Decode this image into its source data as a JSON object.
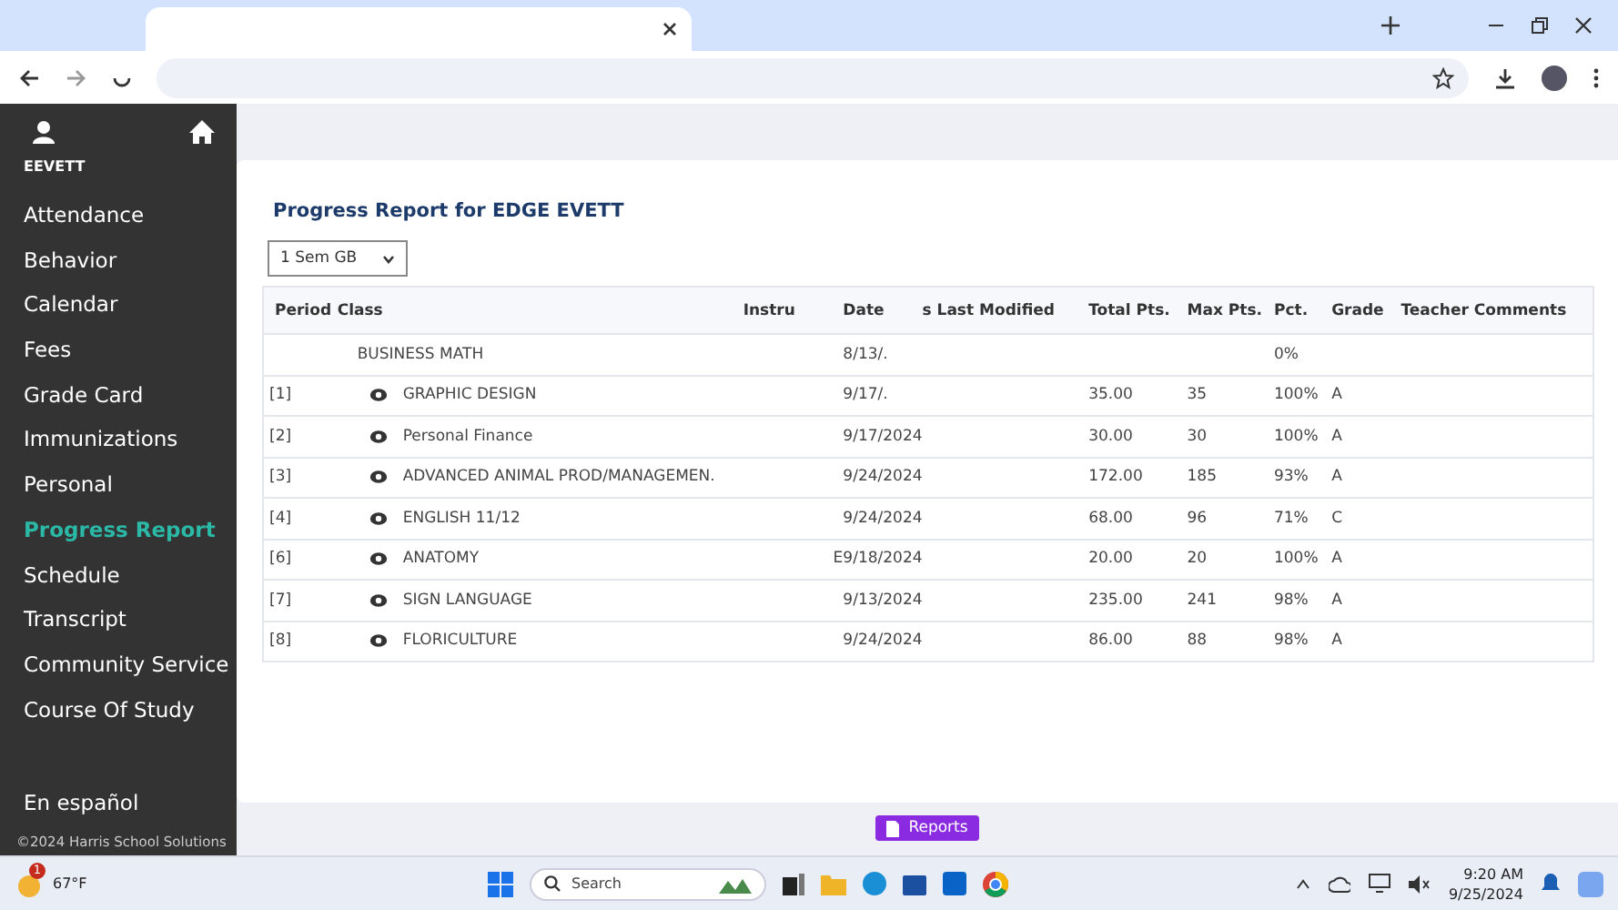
{
  "sidebar": {
    "user_name": "EEVETT",
    "items": [
      {
        "label": "Attendance",
        "selected": false
      },
      {
        "label": "Behavior",
        "selected": false
      },
      {
        "label": "Calendar",
        "selected": false
      },
      {
        "label": "Fees",
        "selected": false
      },
      {
        "label": "Grade Card",
        "selected": false
      },
      {
        "label": "Immunizations",
        "selected": false
      },
      {
        "label": "Personal",
        "selected": false
      },
      {
        "label": "Progress Report",
        "selected": true
      },
      {
        "label": "Schedule",
        "selected": false
      },
      {
        "label": "Transcript",
        "selected": false
      },
      {
        "label": "Community Service",
        "selected": false
      },
      {
        "label": "Course Of Study",
        "selected": false
      }
    ],
    "language_link": "En español",
    "copyright": "©2024",
    "copyright_link": "Harris School Solutions"
  },
  "report": {
    "title": "Progress Report for EDGE EVETT",
    "term_select": "1 Sem GB",
    "table": {
      "columns": [
        "Period",
        "Class",
        "Instru",
        "Date",
        "s Last Modified",
        "Total Pts.",
        "Max Pts.",
        "Pct.",
        "Grade",
        "Teacher Comments"
      ],
      "rows": [
        {
          "kind": "plain",
          "period": "",
          "class": "BUSINESS MATH",
          "instructor": "",
          "date": "8/13/.",
          "total": "",
          "max": "",
          "pct": "0%",
          "grade": ""
        },
        {
          "kind": "course",
          "period": "[1]",
          "class": "GRAPHIC DESIGN",
          "instructor": "",
          "date": "9/17/.",
          "total": "35.00",
          "max": "35",
          "pct": "100%",
          "grade": "A"
        },
        {
          "kind": "course",
          "period": "[2]",
          "class": "Personal Finance",
          "instructor": "",
          "date": "9/17/2024",
          "total": "30.00",
          "max": "30",
          "pct": "100%",
          "grade": "A"
        },
        {
          "kind": "course",
          "period": "[3]",
          "class": "ADVANCED ANIMAL PROD/MANAGEMEN.",
          "instructor": "",
          "date": "9/24/2024",
          "total": "172.00",
          "max": "185",
          "pct": "93%",
          "grade": "A"
        },
        {
          "kind": "course",
          "period": "[4]",
          "class": "ENGLISH 11/12",
          "instructor": "",
          "date": "9/24/2024",
          "total": "68.00",
          "max": "96",
          "pct": "71%",
          "grade": "C"
        },
        {
          "kind": "course",
          "period": "[6]",
          "class": "ANATOMY",
          "instructor": "E",
          "date": "9/18/2024",
          "total": "20.00",
          "max": "20",
          "pct": "100%",
          "grade": "A"
        },
        {
          "kind": "course",
          "period": "[7]",
          "class": "SIGN LANGUAGE",
          "instructor": "",
          "date": "9/13/2024",
          "total": "235.00",
          "max": "241",
          "pct": "98%",
          "grade": "A"
        },
        {
          "kind": "course",
          "period": "[8]",
          "class": "FLORICULTURE",
          "instructor": "",
          "date": "9/24/2024",
          "total": "86.00",
          "max": "88",
          "pct": "98%",
          "grade": "A"
        }
      ]
    }
  },
  "footer": {
    "button": "Reports"
  },
  "taskbar": {
    "weather": "67°F",
    "weather_badge": "1",
    "search_placeholder": "Search",
    "time": "9:20 AM",
    "date": "9/25/2024"
  }
}
